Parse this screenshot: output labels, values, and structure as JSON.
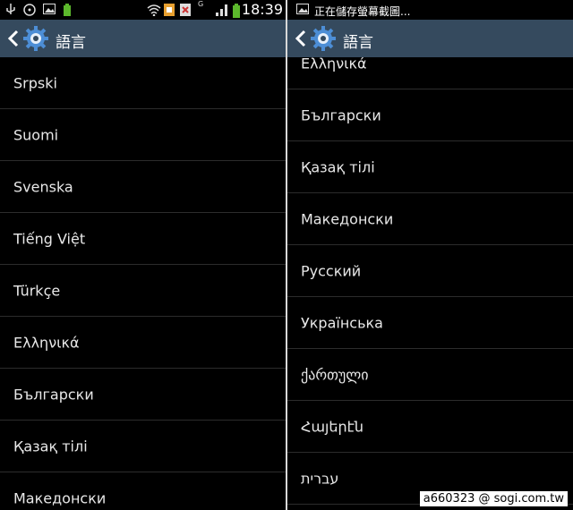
{
  "left_panel": {
    "status": {
      "time": "18:39",
      "battery_color": "#5cb82c"
    },
    "actionbar": {
      "title": "語言",
      "bg": "#354a5e"
    },
    "items": [
      "Srpski",
      "Suomi",
      "Svenska",
      "Tiếng Việt",
      "Türkçe",
      "Ελληνικά",
      "Български",
      "Қазақ тілі",
      "Македонски"
    ]
  },
  "right_panel": {
    "status": {
      "notification": "正在儲存螢幕截圖..."
    },
    "actionbar": {
      "title": "語言"
    },
    "items": [
      "Ελληνικά",
      "Български",
      "Қазақ тілі",
      "Македонски",
      "Русский",
      "Українська",
      "ქართული",
      "Հայերէն",
      "עברית"
    ]
  },
  "watermark": {
    "user": "a660323",
    "site": "@ sogi.com.tw"
  }
}
